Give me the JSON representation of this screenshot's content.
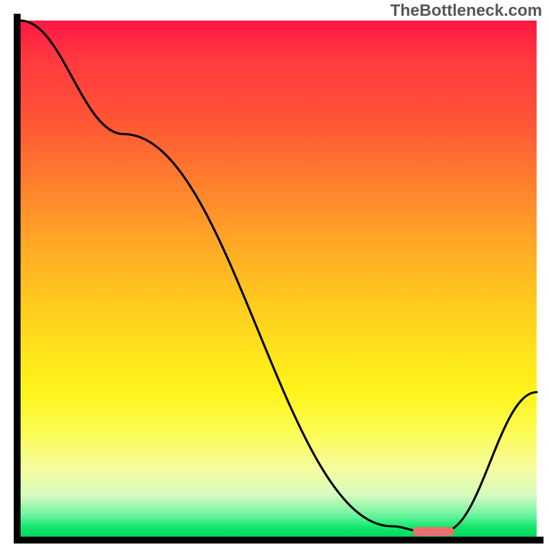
{
  "watermark": "TheBottleneck.com",
  "chart_data": {
    "type": "line",
    "title": "",
    "xlabel": "",
    "ylabel": "",
    "xlim": [
      0,
      100
    ],
    "ylim": [
      0,
      100
    ],
    "grid": false,
    "legend": null,
    "gradient_meaning": "background encodes severity: red (top) = worst, green (bottom) = best",
    "series": [
      {
        "name": "bottleneck-curve",
        "x": [
          0,
          20,
          72,
          78,
          82,
          100
        ],
        "y": [
          100,
          78,
          2,
          1,
          1,
          28
        ]
      }
    ],
    "marker": {
      "name": "optimal-zone",
      "x_range": [
        76,
        84
      ],
      "y": 1,
      "color": "#eb6e6e"
    }
  }
}
